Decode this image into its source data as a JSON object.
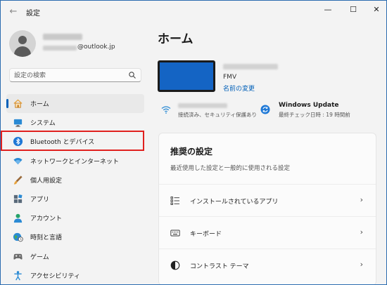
{
  "window": {
    "back_glyph": "←",
    "title": "設定",
    "controls": {
      "minimize": "—",
      "maximize": "☐",
      "close": "✕"
    }
  },
  "profile": {
    "email_suffix": "@outlook.jp"
  },
  "search": {
    "placeholder": "設定の検索"
  },
  "nav": {
    "items": [
      {
        "label": "ホーム",
        "icon": "home-icon",
        "active": true
      },
      {
        "label": "システム",
        "icon": "system-icon"
      },
      {
        "label": "Bluetooth とデバイス",
        "icon": "bluetooth-icon",
        "highlighted": true
      },
      {
        "label": "ネットワークとインターネット",
        "icon": "network-icon"
      },
      {
        "label": "個人用設定",
        "icon": "brush-icon"
      },
      {
        "label": "アプリ",
        "icon": "apps-icon"
      },
      {
        "label": "アカウント",
        "icon": "account-icon"
      },
      {
        "label": "時刻と言語",
        "icon": "globe-clock-icon"
      },
      {
        "label": "ゲーム",
        "icon": "gamepad-icon"
      },
      {
        "label": "アクセシビリティ",
        "icon": "accessibility-icon"
      }
    ]
  },
  "main": {
    "title": "ホーム",
    "device": {
      "model": "FMV",
      "rename_link": "名前の変更"
    },
    "wifi": {
      "status": "接続済み、セキュリティ保護あり"
    },
    "update": {
      "title": "Windows Update",
      "last_checked": "最終チェック日時 : 19 時間前"
    },
    "recommended": {
      "title": "推奨の設定",
      "subtitle": "最近使用した設定と一般的に使用される設定",
      "items": [
        {
          "label": "インストールされているアプリ",
          "icon": "installed-apps-icon"
        },
        {
          "label": "キーボード",
          "icon": "keyboard-icon"
        },
        {
          "label": "コントラスト テーマ",
          "icon": "contrast-icon"
        }
      ],
      "chevron": "›"
    }
  },
  "colors": {
    "accent": "#005fb8",
    "highlight_box": "#e0201e",
    "device_screen": "#1464c4"
  }
}
